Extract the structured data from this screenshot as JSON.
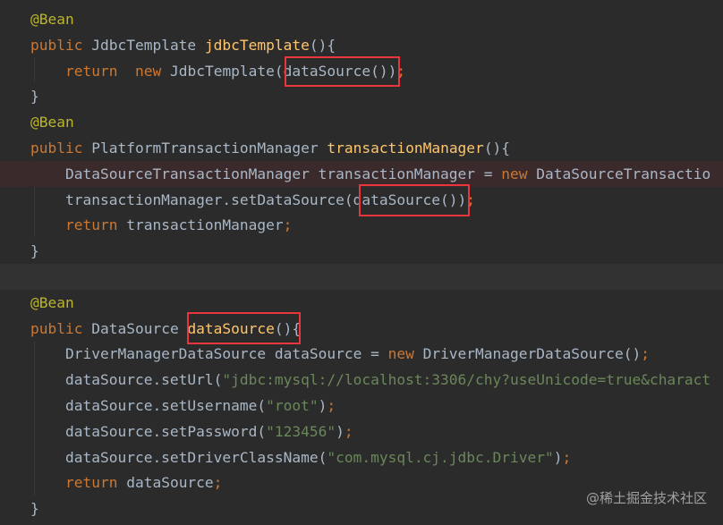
{
  "code_lines": [
    [
      {
        "t": "@Bean",
        "c": "ann"
      }
    ],
    [
      {
        "t": "public",
        "c": "kw"
      },
      {
        "t": " JdbcTemplate ",
        "c": "pl"
      },
      {
        "t": "jdbcTemplate",
        "c": "fn"
      },
      {
        "t": "(){",
        "c": "pl"
      }
    ],
    [
      {
        "t": "    return",
        "c": "kw"
      },
      {
        "t": "  ",
        "c": "pl"
      },
      {
        "t": "new",
        "c": "kw"
      },
      {
        "t": " JdbcTemplate(dataSource())",
        "c": "pl"
      },
      {
        "t": ";",
        "c": "kw"
      }
    ],
    [
      {
        "t": "}",
        "c": "pl"
      }
    ],
    [
      {
        "t": "@Bean",
        "c": "ann"
      }
    ],
    [
      {
        "t": "public",
        "c": "kw"
      },
      {
        "t": " PlatformTransactionManager ",
        "c": "pl"
      },
      {
        "t": "transactionManager",
        "c": "fn"
      },
      {
        "t": "(){",
        "c": "pl"
      }
    ],
    [
      {
        "t": "    DataSourceTransactionManager transactionManager = ",
        "c": "pl"
      },
      {
        "t": "new",
        "c": "kw"
      },
      {
        "t": " DataSourceTransactio",
        "c": "pl"
      }
    ],
    [
      {
        "t": "    transactionManager.setDataSource(dataSource())",
        "c": "pl"
      },
      {
        "t": ";",
        "c": "kw"
      }
    ],
    [
      {
        "t": "    return",
        "c": "kw"
      },
      {
        "t": " transactionManager",
        "c": "pl"
      },
      {
        "t": ";",
        "c": "kw"
      }
    ],
    [
      {
        "t": "}",
        "c": "pl"
      }
    ],
    [],
    [
      {
        "t": "@Bean",
        "c": "ann"
      }
    ],
    [
      {
        "t": "public",
        "c": "kw"
      },
      {
        "t": " DataSource ",
        "c": "pl"
      },
      {
        "t": "dataSource",
        "c": "fn"
      },
      {
        "t": "(){",
        "c": "pl"
      }
    ],
    [
      {
        "t": "    DriverManagerDataSource dataSource = ",
        "c": "pl"
      },
      {
        "t": "new",
        "c": "kw"
      },
      {
        "t": " DriverManagerDataSource()",
        "c": "pl"
      },
      {
        "t": ";",
        "c": "kw"
      }
    ],
    [
      {
        "t": "    dataSource.setUrl(",
        "c": "pl"
      },
      {
        "t": "\"jdbc:mysql://localhost:3306/chy?useUnicode=true&charact",
        "c": "str"
      }
    ],
    [
      {
        "t": "    dataSource.setUsername(",
        "c": "pl"
      },
      {
        "t": "\"root\"",
        "c": "str"
      },
      {
        "t": ")",
        "c": "pl"
      },
      {
        "t": ";",
        "c": "kw"
      }
    ],
    [
      {
        "t": "    dataSource.setPassword(",
        "c": "pl"
      },
      {
        "t": "\"123456\"",
        "c": "str"
      },
      {
        "t": ")",
        "c": "pl"
      },
      {
        "t": ";",
        "c": "kw"
      }
    ],
    [
      {
        "t": "    dataSource.setDriverClassName(",
        "c": "pl"
      },
      {
        "t": "\"com.mysql.cj.jdbc.Driver\"",
        "c": "str"
      },
      {
        "t": ")",
        "c": "pl"
      },
      {
        "t": ";",
        "c": "kw"
      }
    ],
    [
      {
        "t": "    return",
        "c": "kw"
      },
      {
        "t": " dataSource",
        "c": "pl"
      },
      {
        "t": ";",
        "c": "kw"
      }
    ],
    [
      {
        "t": "}",
        "c": "pl"
      }
    ]
  ],
  "error_line_index": 6,
  "current_line_index": 10,
  "colors": {
    "background": "#2b2b2b",
    "keyword": "#cc7832",
    "annotation": "#bbb529",
    "method": "#ffc66d",
    "string": "#6a8759",
    "plain": "#a9b7c6",
    "highlight_box": "#e8363c"
  },
  "watermark": "@稀土掘金技术社区"
}
